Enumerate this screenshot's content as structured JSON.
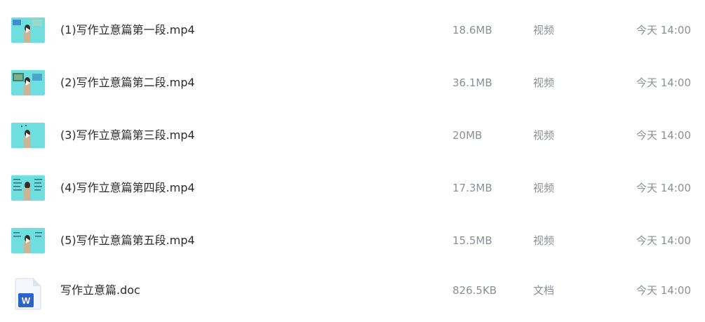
{
  "files": [
    {
      "name": "(1)写作立意篇第一段.mp4",
      "size": "18.6MB",
      "type": "视频",
      "modified": "今天 14:00",
      "icon": "video-thumbnail-icon"
    },
    {
      "name": "(2)写作立意篇第二段.mp4",
      "size": "36.1MB",
      "type": "视频",
      "modified": "今天 14:00",
      "icon": "video-thumbnail-icon"
    },
    {
      "name": "(3)写作立意篇第三段.mp4",
      "size": "20MB",
      "type": "视频",
      "modified": "今天 14:00",
      "icon": "video-thumbnail-icon"
    },
    {
      "name": "(4)写作立意篇第四段.mp4",
      "size": "17.3MB",
      "type": "视频",
      "modified": "今天 14:00",
      "icon": "video-thumbnail-icon"
    },
    {
      "name": "(5)写作立意篇第五段.mp4",
      "size": "15.5MB",
      "type": "视频",
      "modified": "今天 14:00",
      "icon": "video-thumbnail-icon"
    },
    {
      "name": "写作立意篇.doc",
      "size": "826.5KB",
      "type": "文档",
      "modified": "今天 14:00",
      "icon": "word-document-icon",
      "icon_letter": "W"
    }
  ],
  "colors": {
    "thumbnail_bg": "#6fdede",
    "word_blue": "#2b63c9",
    "name_text": "#2b2b2b",
    "meta_text": "#8a8f99"
  }
}
